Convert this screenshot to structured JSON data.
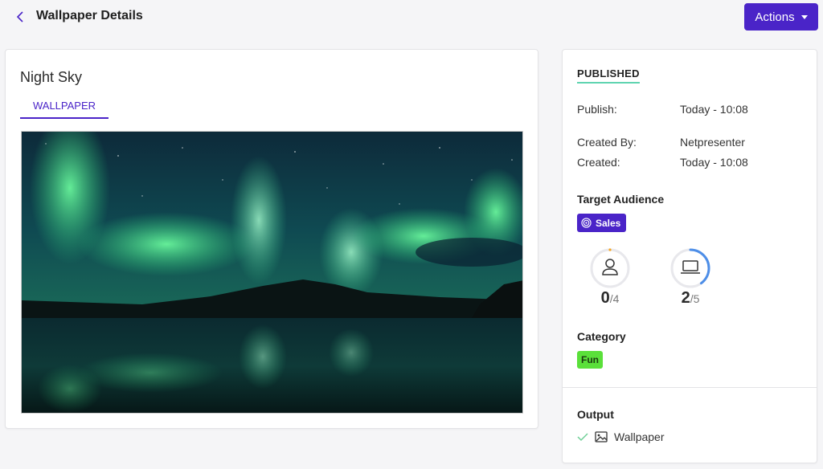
{
  "header": {
    "title": "Wallpaper Details",
    "actions_label": "Actions"
  },
  "wallpaper": {
    "name": "Night Sky",
    "tab_label": "WALLPAPER"
  },
  "details": {
    "status": "PUBLISHED",
    "publish_label": "Publish:",
    "publish_value": "Today - 10:08",
    "created_by_label": "Created By:",
    "created_by_value": "Netpresenter",
    "created_label": "Created:",
    "created_value": "Today - 10:08",
    "target_audience_title": "Target Audience",
    "audience_tag": "Sales",
    "users_stat": {
      "value": "0",
      "total": "/4",
      "fraction": 0
    },
    "devices_stat": {
      "value": "2",
      "total": "/5",
      "fraction": 0.4
    },
    "category_title": "Category",
    "category_tag": "Fun",
    "output_title": "Output",
    "output_item": "Wallpaper"
  },
  "colors": {
    "accent": "#4a24c8",
    "status_underline": "#5ed4b0",
    "ring_progress": "#4d8ee8",
    "user_dot": "#f5a623",
    "category_tag": "#5ae03a"
  }
}
